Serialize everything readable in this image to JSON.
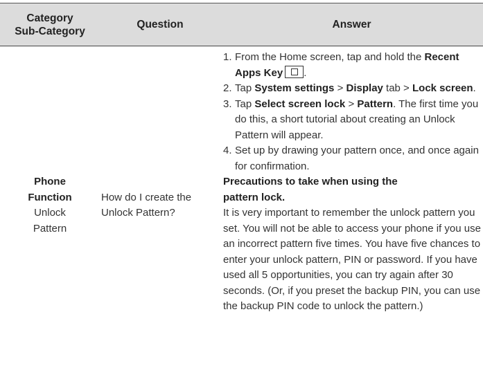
{
  "table": {
    "headers": {
      "category_line1": "Category",
      "category_line2": "Sub-Category",
      "question": "Question",
      "answer": "Answer"
    },
    "row": {
      "category": "Phone Function",
      "category_line1": "Phone",
      "category_line2": "Function",
      "subcategory_line1": "Unlock",
      "subcategory_line2": "Pattern",
      "question_line1": "How do I create the",
      "question_line2": "Unlock Pattern?",
      "steps": {
        "s1": {
          "num": "1.",
          "text1": "From the Home screen, tap and hold the",
          "bold1": "Recent Apps Key",
          "key_icon": "recent-apps-key-icon",
          "end": "."
        },
        "s2": {
          "num": "2.",
          "text1": "Tap ",
          "bold1": "System settings",
          "text2": " > ",
          "bold2": "Display",
          "text3": " tab >",
          "bold3": "Lock screen",
          "end": "."
        },
        "s3": {
          "num": "3.",
          "text1": "Tap ",
          "bold1": "Select screen lock",
          "text2": " > ",
          "bold2": "Pattern",
          "text3": ". The first time you do this, a short tutorial about creating an Unlock Pattern will appear."
        },
        "s4": {
          "num": "4.",
          "text1": "Set up by drawing your pattern once, and once again for confirmation."
        }
      },
      "precautions_title_line1": "Precautions to take when using the",
      "precautions_title_line2": "pattern lock.",
      "precautions_body": "It is very important to remember the unlock pattern you set. You will not be able to access your phone if you use an incorrect pattern five times. You have five chances to enter your unlock pattern, PIN or password. If you have used all 5 opportunities, you can try again after 30 seconds. (Or, if you preset the backup PIN, you can use the backup PIN code to unlock the pattern.)"
    }
  }
}
